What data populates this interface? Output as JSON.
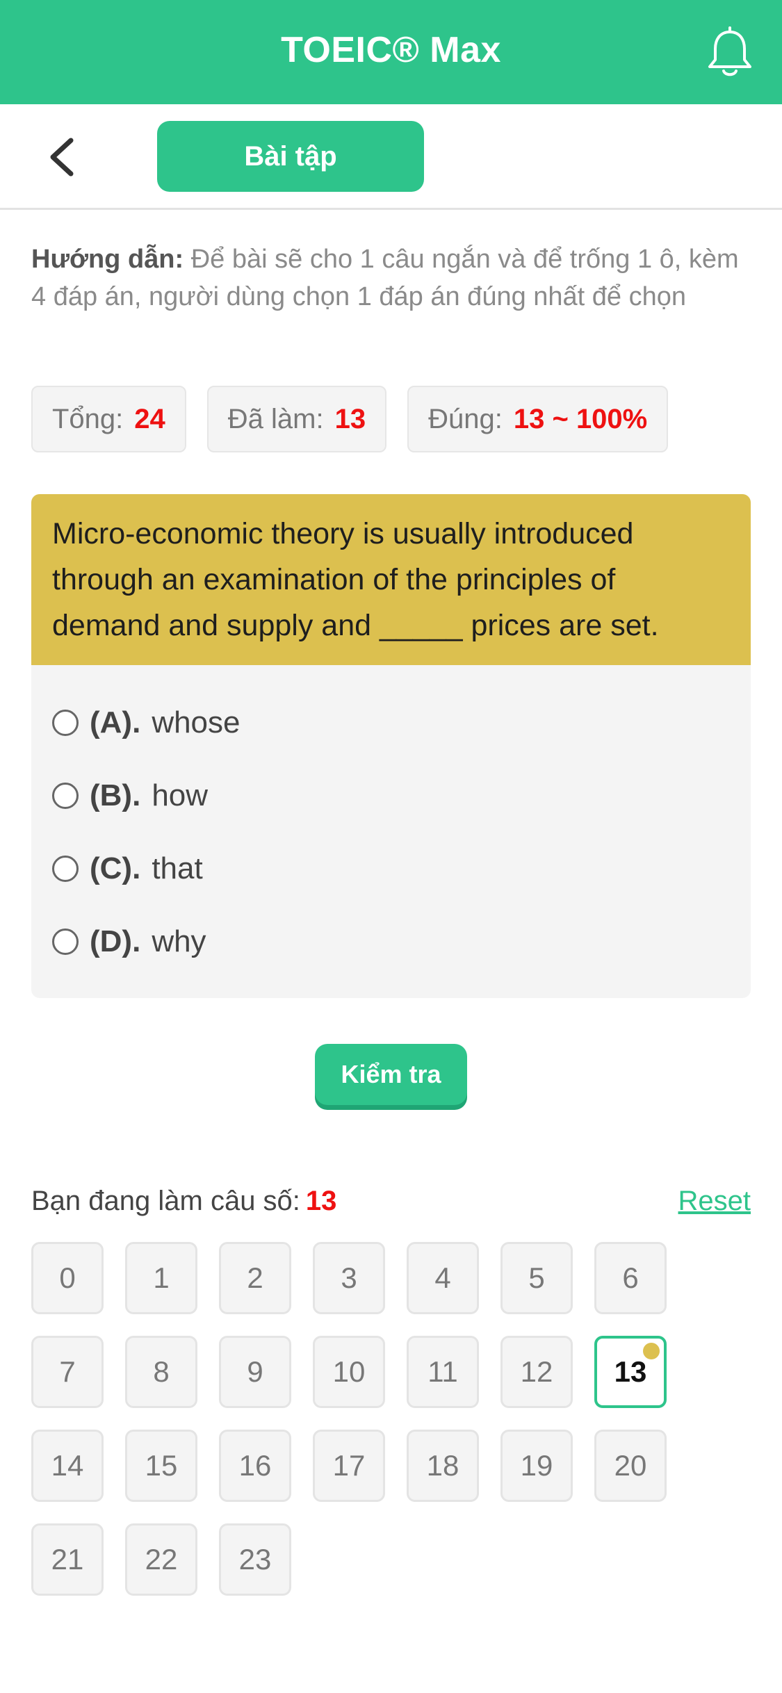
{
  "header": {
    "title": "TOEIC® Max"
  },
  "subbar": {
    "tab_label": "Bài tập"
  },
  "instructions": {
    "label": "Hướng dẫn:",
    "text": " Để bài sẽ cho 1 câu ngắn và để trống 1 ô, kèm 4 đáp án, người dùng chọn 1 đáp án đúng nhất để chọn"
  },
  "stats": [
    {
      "label": "Tổng:",
      "value": "24"
    },
    {
      "label": "Đã làm:",
      "value": "13"
    },
    {
      "label": "Đúng:",
      "value": "13 ~ 100%"
    }
  ],
  "question": {
    "text": "Micro-economic theory is usually introduced through an examination of the principles of demand and supply and _____ prices are set.",
    "options": [
      {
        "key": "(A).",
        "text": "whose"
      },
      {
        "key": "(B).",
        "text": "how"
      },
      {
        "key": "(C).",
        "text": "that"
      },
      {
        "key": "(D).",
        "text": "why"
      }
    ]
  },
  "check_button": "Kiểm tra",
  "progress": {
    "label": "Bạn đang làm câu số:",
    "current": "13",
    "reset": "Reset"
  },
  "grid": [
    "0",
    "1",
    "2",
    "3",
    "4",
    "5",
    "6",
    "7",
    "8",
    "9",
    "10",
    "11",
    "12",
    "13",
    "14",
    "15",
    "16",
    "17",
    "18",
    "19",
    "20",
    "21",
    "22",
    "23"
  ],
  "colors": {
    "brand": "#2ec48b",
    "question_bg": "#dcc04f",
    "highlight": "#e11111"
  }
}
